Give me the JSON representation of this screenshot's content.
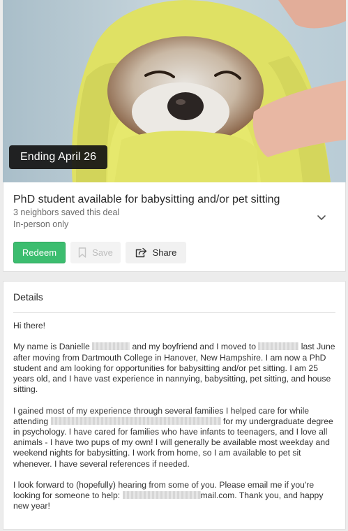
{
  "hero": {
    "badge": "Ending April 26",
    "colors": {
      "towel": "#e3e565",
      "background": "#b7c9d2",
      "dog_fur": "#9a6a44"
    }
  },
  "deal": {
    "title": "PhD student available for babysitting and/or pet sitting",
    "saved_count": "3 neighbors saved this deal",
    "mode": "In-person only",
    "expand_icon": "chevron-down-icon",
    "buttons": {
      "redeem": "Redeem",
      "save": "Save",
      "save_icon": "bookmark-icon",
      "share": "Share",
      "share_icon": "share-icon"
    },
    "colors": {
      "redeem": "#3cbd6f"
    }
  },
  "details": {
    "heading": "Details",
    "greeting": "Hi there!",
    "p1": {
      "a": "My name is Danielle",
      "b": "and my boyfriend and I moved to",
      "c": "last June after moving from Dartmouth College in Hanover, New Hampshire. I am now a PhD student and am looking for opportunities for babysitting and/or pet sitting. I am 25 years old, and I have vast experience in nannying, babysitting, pet sitting, and house sitting."
    },
    "p2": {
      "a": "I gained most of my experience through several families I helped care for while attending",
      "b": "for my undergraduate degree in psychology. I have cared for families who have infants to teenagers, and I love all animals - I have two pups of my own! I will generally be available most weekday and weekend nights for babysitting. I work from home, so I am available to pet sit whenever. I have several references if needed."
    },
    "p3": {
      "a": "I look forward to (hopefully) hearing from some of you. Please email me if you're looking for someone to help:",
      "b": "mail.com. Thank you, and happy new year!"
    }
  }
}
